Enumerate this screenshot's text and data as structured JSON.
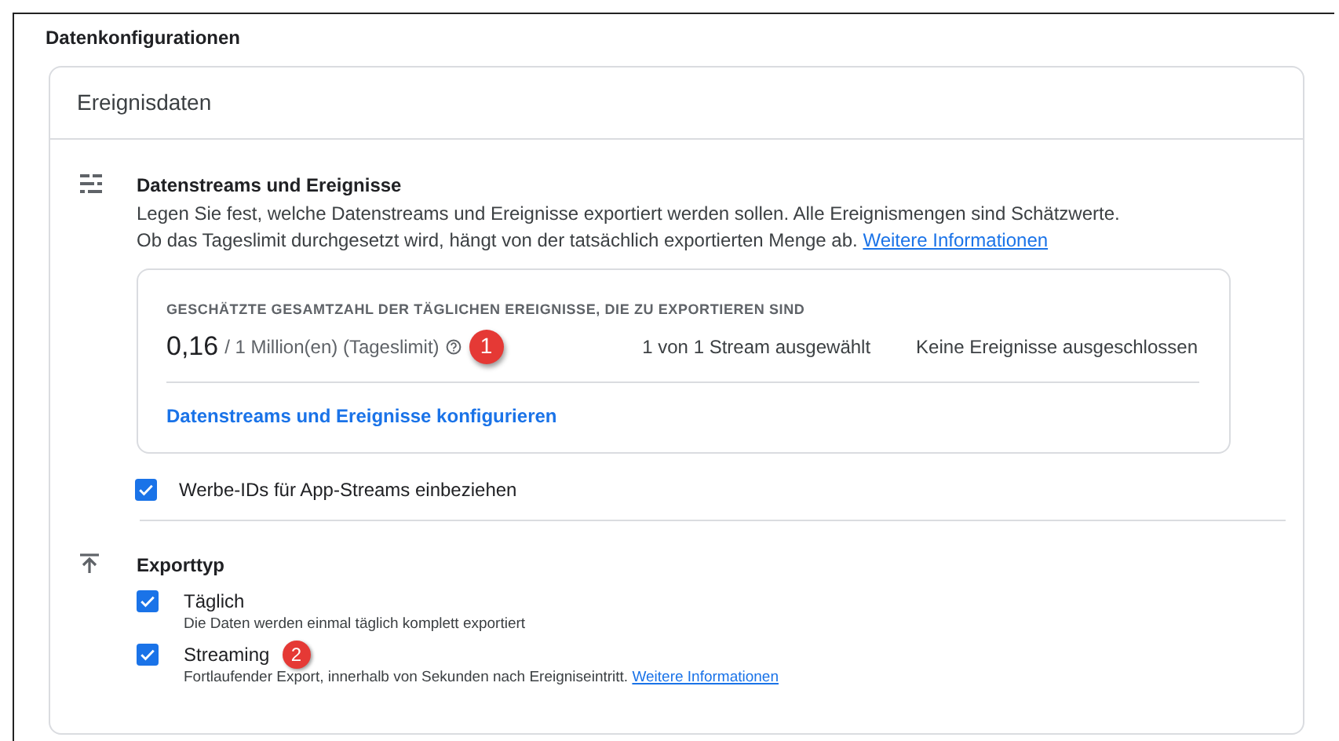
{
  "page_title": "Datenkonfigurationen",
  "card_title": "Ereignisdaten",
  "streams_section": {
    "title": "Datenstreams und Ereignisse",
    "description": "Legen Sie fest, welche Datenstreams und Ereignisse exportiert werden sollen. Alle Ereignismengen sind Schätzwerte. Ob das Tageslimit durchgesetzt wird, hängt von der tatsächlich exportierten Menge ab.",
    "link": "Weitere Informationen",
    "estimate": {
      "label": "GESCHÄTZTE GESAMTZAHL DER TÄGLICHEN EREIGNISSE, DIE ZU EXPORTIEREN SIND",
      "value": "0,16",
      "limit": "/ 1 Million(en) (Tageslimit)",
      "streams": "1 von 1 Stream ausgewählt",
      "exclusions": "Keine Ereignisse ausgeschlossen",
      "callout": "1",
      "action": "Datenstreams und Ereignisse konfigurieren"
    },
    "option": {
      "label": "Werbe-IDs für App-Streams einbeziehen",
      "checked": true
    }
  },
  "export_section": {
    "title": "Exporttyp",
    "options": [
      {
        "label": "Täglich",
        "description": "Die Daten werden einmal täglich komplett exportiert",
        "checked": true
      },
      {
        "label": "Streaming",
        "description": "Fortlaufender Export, innerhalb von Sekunden nach Ereigniseintritt.",
        "link": "Weitere Informationen",
        "checked": true,
        "callout": "2"
      }
    ]
  }
}
